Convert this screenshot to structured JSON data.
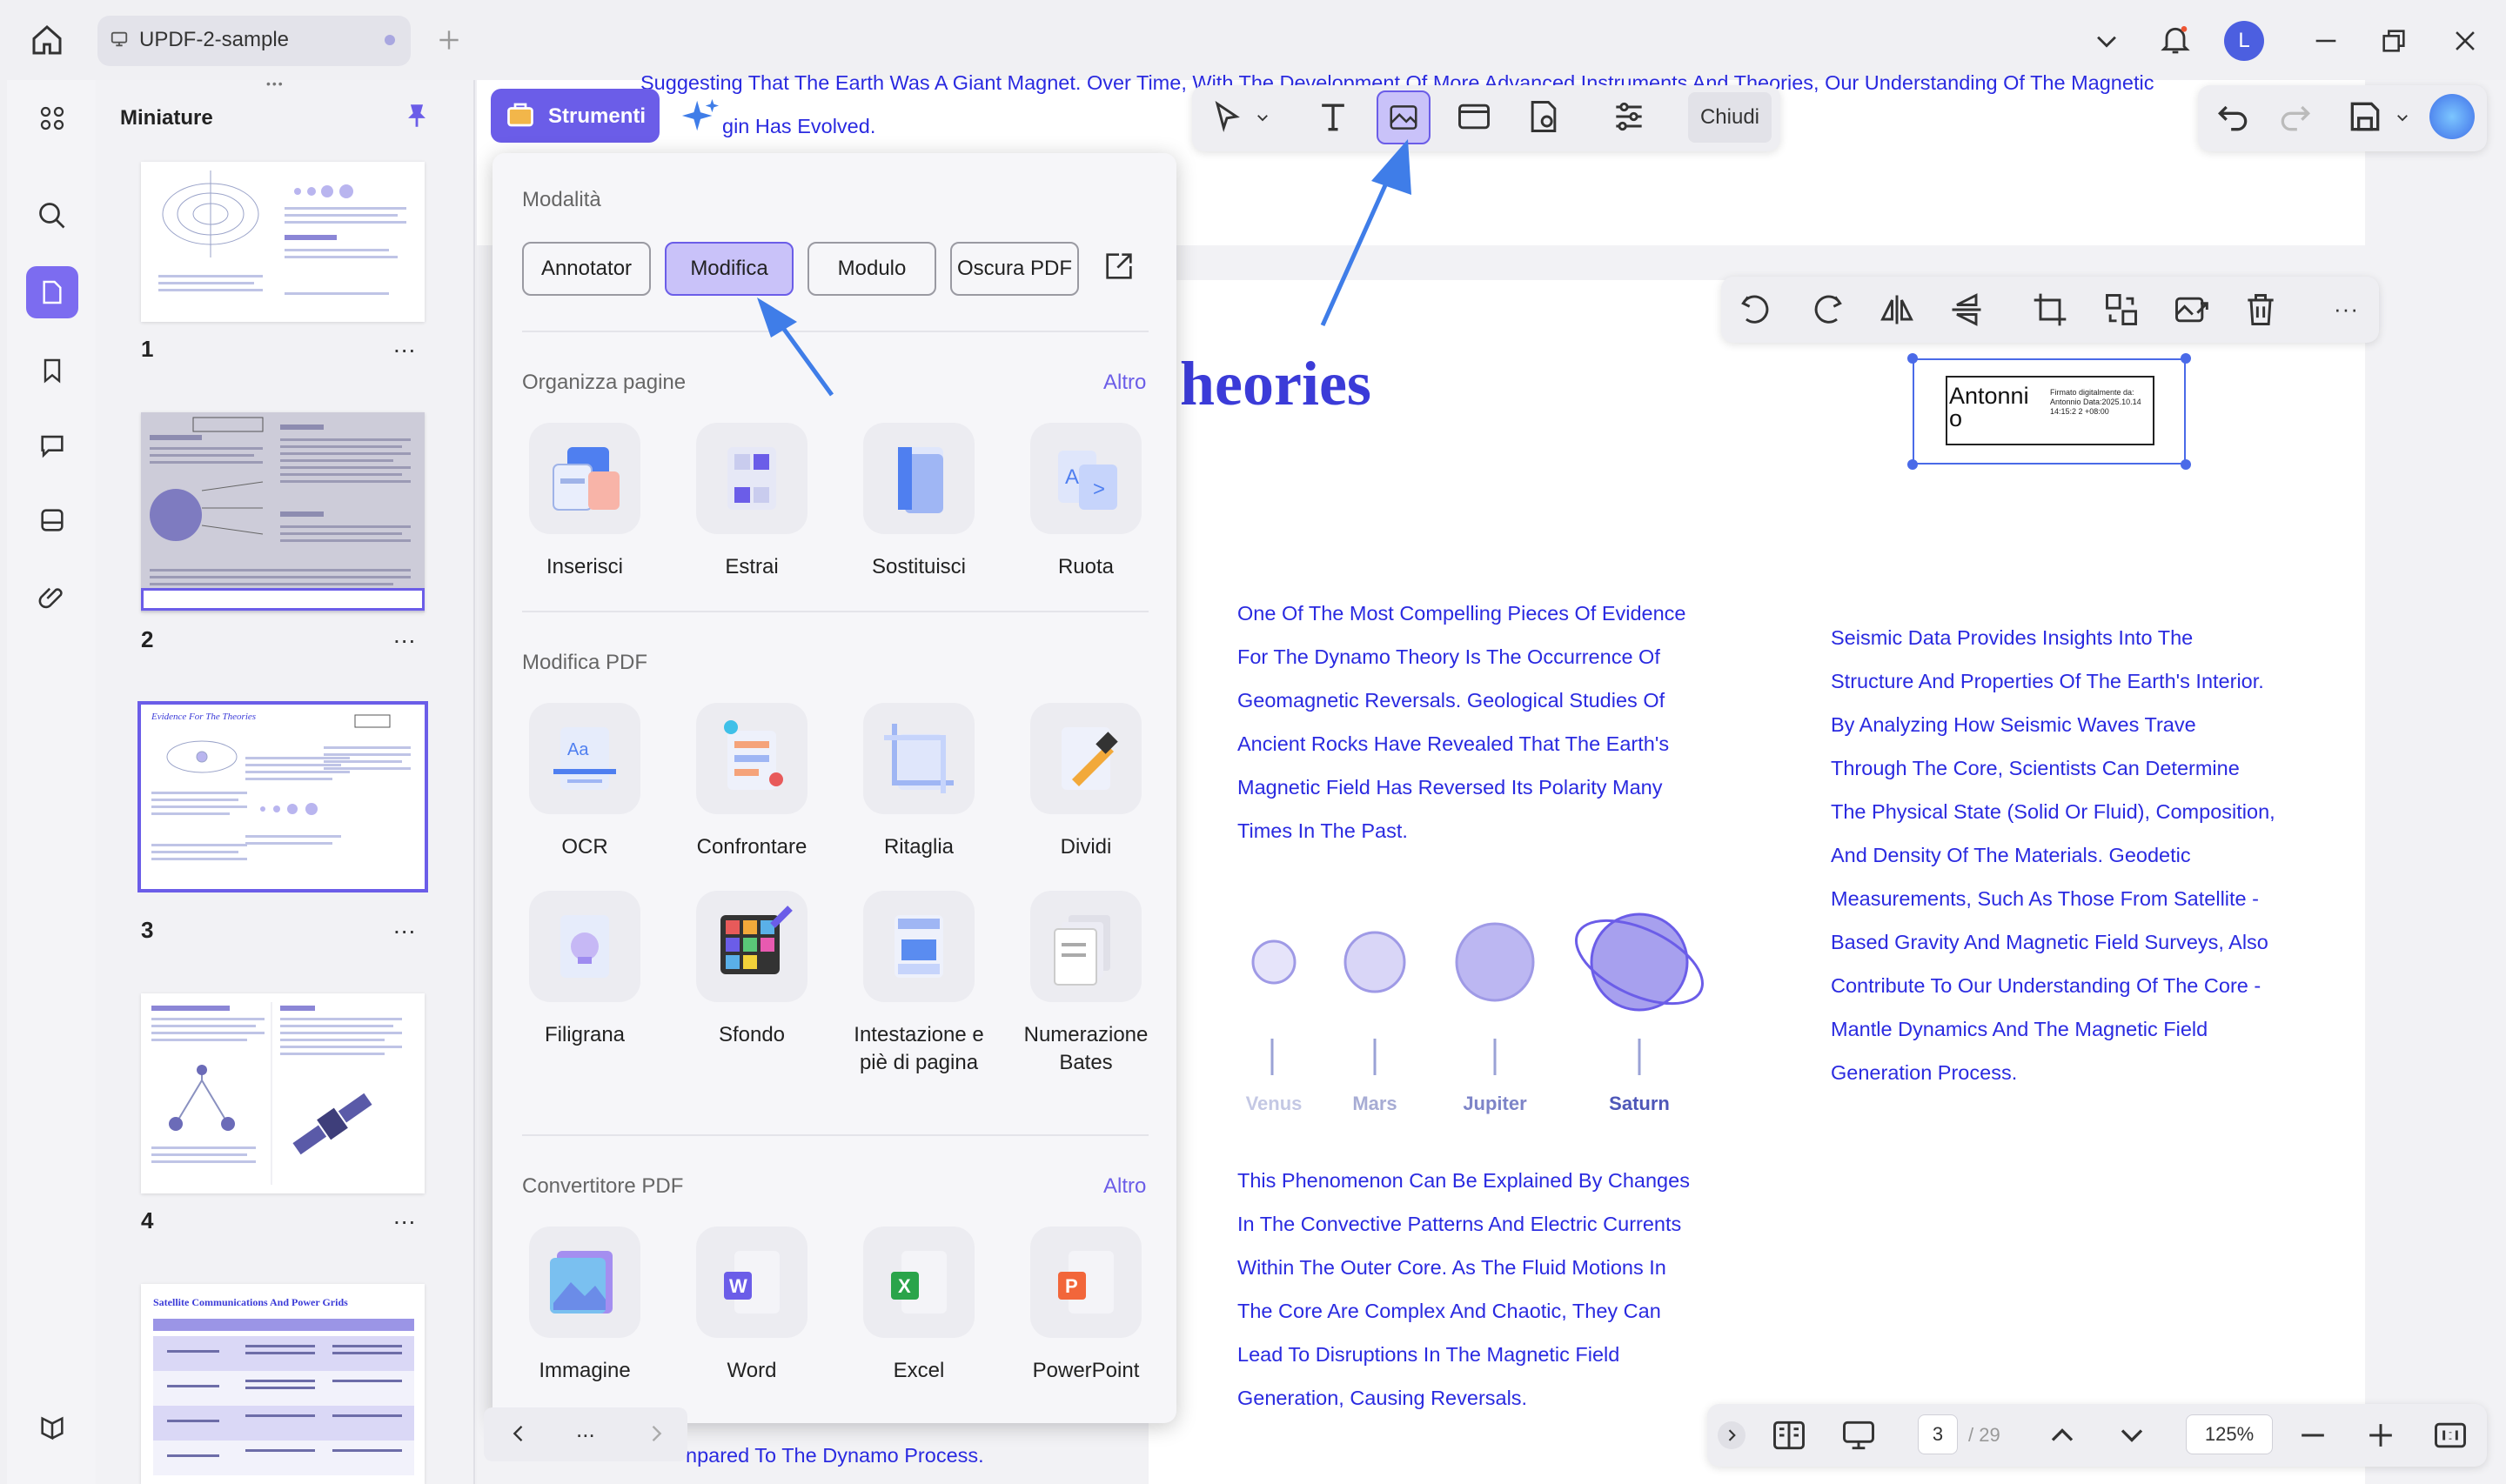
{
  "tab": {
    "title": "UPDF-2-sample"
  },
  "user": {
    "initial": "L"
  },
  "panel": {
    "title": "Miniature"
  },
  "thumbnails": [
    {
      "num": "1",
      "more": "..."
    },
    {
      "num": "2",
      "more": "..."
    },
    {
      "num": "3",
      "more": "..."
    },
    {
      "num": "4",
      "more": "..."
    }
  ],
  "thumb3_title": "Evidence For The Theories",
  "thumb5_title": "Satellite Communications And Power Grids",
  "strumenti": {
    "label": "Strumenti"
  },
  "toolbar": {
    "close_label": "Chiudi"
  },
  "popup": {
    "modes_title": "Modalità",
    "modes": [
      "Annotator",
      "Modifica",
      "Modulo",
      "Oscura PDF"
    ],
    "organize_title": "Organizza pagine",
    "organize_more": "Altro",
    "organize_tools": [
      "Inserisci",
      "Estrai",
      "Sostituisci",
      "Ruota"
    ],
    "edit_title": "Modifica PDF",
    "edit_tools": [
      "OCR",
      "Confrontare",
      "Ritaglia",
      "Dividi",
      "Filigrana",
      "Sfondo",
      "Intestazione e piè di pagina",
      "Numerazione Bates"
    ],
    "convert_title": "Convertitore PDF",
    "convert_more": "Altro",
    "convert_tools": [
      "Immagine",
      "Word",
      "Excel",
      "PowerPoint"
    ]
  },
  "doc": {
    "top_line1": "Suggesting That The Earth Was A Giant Magnet. Over Time, With The Development Of More Advanced Instruments And Theories, Our Understanding Of The Magnetic",
    "top_line2": "gin Has Evolved.",
    "heading": "heories",
    "col1": [
      "One Of The Most Compelling Pieces Of Evidence",
      "For The Dynamo Theory Is The Occurrence Of",
      "Geomagnetic Reversals. Geological Studies Of",
      "Ancient Rocks Have Revealed That The Earth's",
      "Magnetic Field Has Reversed Its Polarity Many",
      "Times In The Past."
    ],
    "col2": [
      "Seismic Data Provides Insights Into The",
      "Structure And Properties Of The Earth's Interior.",
      "By Analyzing How Seismic Waves Trave",
      "Through The Core, Scientists Can Determine",
      "The Physical State (Solid Or Fluid), Composition,",
      "And Density Of The Materials. Geodetic",
      "Measurements, Such As Those From Satellite -",
      "Based Gravity And Magnetic Field Surveys, Also",
      "Contribute To Our Understanding Of The Core -",
      "Mantle Dynamics And The Magnetic Field",
      "Generation Process."
    ],
    "col3": [
      "This Phenomenon Can Be Explained By Changes",
      "In The Convective Patterns And Electric Currents",
      "Within The Outer Core. As The Fluid Motions In",
      "The Core Are Complex And Chaotic, They Can",
      "Lead To Disruptions In The Magnetic Field",
      "Generation, Causing Reversals."
    ],
    "bottom_line": "npared To The Dynamo Process.",
    "planets": [
      "Venus",
      "Mars",
      "Jupiter",
      "Saturn"
    ],
    "signature": {
      "name": "Antonni o",
      "small": "Firmato digitalmente da: Antonnio Data:2025.10.14 14:15:2 2 +08:00"
    }
  },
  "popup_nav": {
    "more": "..."
  },
  "nav": {
    "page": "3",
    "total": "/ 29",
    "zoom": "125%"
  },
  "colors": {
    "accent": "#6b5de8",
    "doc_text": "#2a2ae0",
    "arrow": "#3f7de8"
  }
}
